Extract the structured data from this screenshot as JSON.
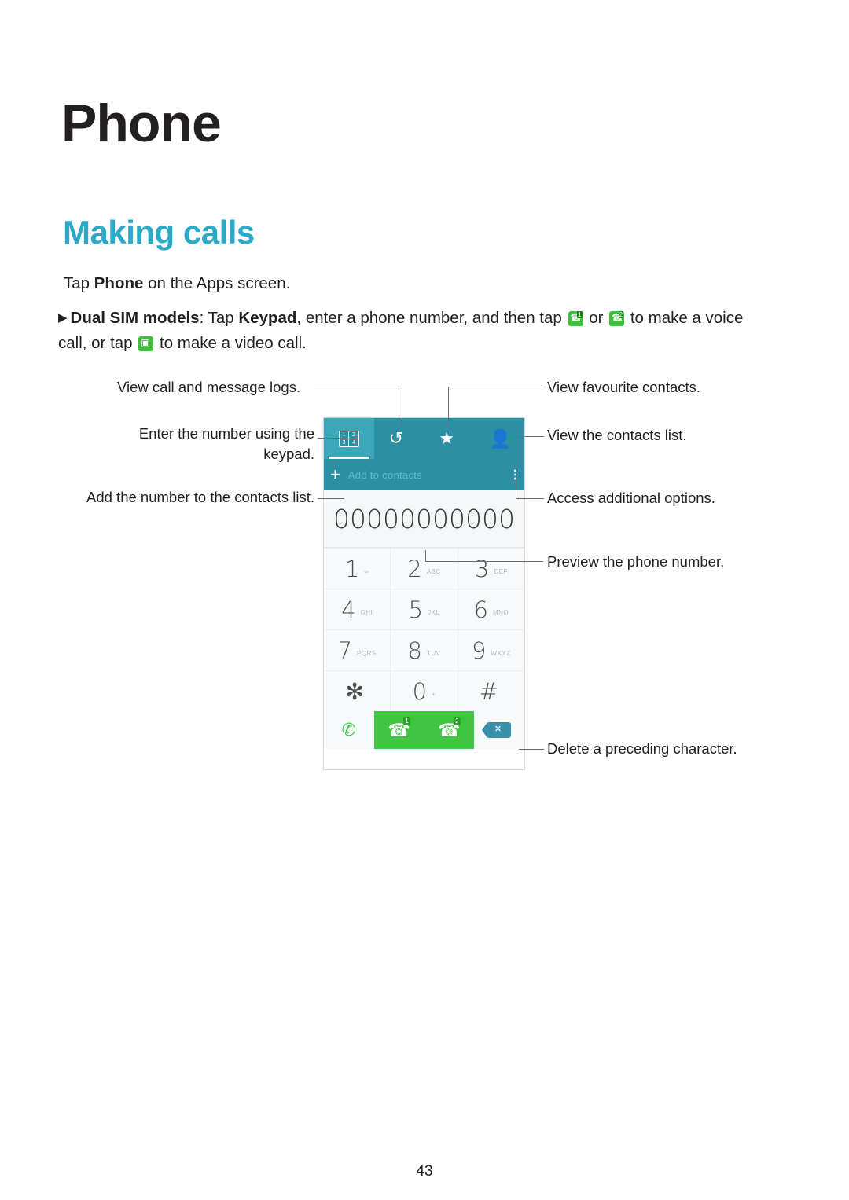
{
  "page": {
    "title": "Phone",
    "section": "Making calls",
    "folio": "43"
  },
  "body": {
    "line1_pre": "Tap ",
    "line1_bold": "Phone",
    "line1_post": " on the Apps screen.",
    "bullet_marker": "▶",
    "bullet_bold": "Dual SIM models",
    "bullet_text_1": ": Tap ",
    "bullet_bold_2": "Keypad",
    "bullet_text_2": ", enter a phone number, and then tap ",
    "bullet_text_3": " or ",
    "bullet_text_4": " to make a voice call, or tap ",
    "bullet_text_5": " to make a video call."
  },
  "callouts": {
    "call_logs": "View call and message logs.",
    "keypad_entry": "Enter the number using the keypad.",
    "add_contacts": "Add the number to the contacts list.",
    "favourites": "View favourite contacts.",
    "contacts_list": "View the contacts list.",
    "more_options": "Access additional options.",
    "preview_number": "Preview the phone number.",
    "delete_char": "Delete a preceding character."
  },
  "phone_ui": {
    "tabs": [
      {
        "name": "keypad",
        "icon": "keypad-icon",
        "keys": [
          "1",
          "2",
          "3",
          "4"
        ]
      },
      {
        "name": "logs",
        "icon": "call-log-icon"
      },
      {
        "name": "favourites",
        "icon": "star-icon"
      },
      {
        "name": "contacts",
        "icon": "person-icon"
      }
    ],
    "add_bar": {
      "plus": "+",
      "label": "Add to contacts",
      "overflow": "more-options-icon"
    },
    "number_display": "00000000000",
    "keypad": [
      {
        "digit": "1",
        "sub": "∞"
      },
      {
        "digit": "2",
        "sub": "ABC"
      },
      {
        "digit": "3",
        "sub": "DEF"
      },
      {
        "digit": "4",
        "sub": "GHI"
      },
      {
        "digit": "5",
        "sub": "JKL"
      },
      {
        "digit": "6",
        "sub": "MNO"
      },
      {
        "digit": "7",
        "sub": "PQRS"
      },
      {
        "digit": "8",
        "sub": "TUV"
      },
      {
        "digit": "9",
        "sub": "WXYZ"
      },
      {
        "digit": "✻",
        "sub": ""
      },
      {
        "digit": "0",
        "sub": "+"
      },
      {
        "digit": "#",
        "sub": ""
      }
    ],
    "actions": [
      {
        "name": "video-call",
        "icon": "video-call-icon",
        "badge": ""
      },
      {
        "name": "call-sim1",
        "icon": "call-icon",
        "badge": "1"
      },
      {
        "name": "call-sim2",
        "icon": "call-icon",
        "badge": "2"
      },
      {
        "name": "backspace",
        "icon": "backspace-icon",
        "badge": ""
      }
    ]
  },
  "colors": {
    "accent": "#2aa9c9",
    "tabbar": "#2c8fa3",
    "call_green": "#3fc53f",
    "text": "#231f20"
  }
}
